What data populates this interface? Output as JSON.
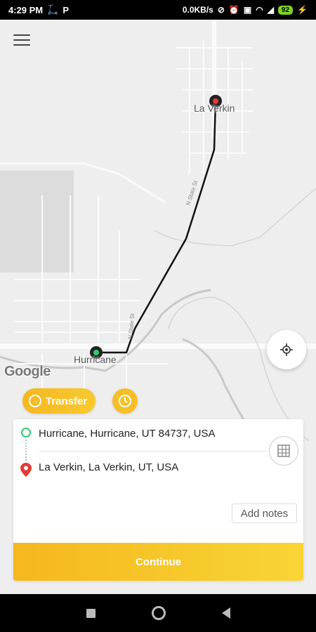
{
  "status_bar": {
    "time": "4:29 PM",
    "network_speed": "0.0KB/s",
    "battery": "92",
    "icons": [
      "scooter-icon",
      "parking-icon",
      "nfc-icon",
      "alarm-icon",
      "sim-icon",
      "wifi-icon",
      "signal-icon",
      "charging-icon"
    ]
  },
  "map": {
    "origin_label": "Hurricane",
    "destination_label": "La Verkin",
    "road_label_1": "N State St",
    "road_label_2": "N State St",
    "attribution": "Google",
    "origin_marker_color": "#2ecc71",
    "destination_marker_color": "#e53935"
  },
  "actions": {
    "transfer_label": "Transfer",
    "accent_color": "#f6bf27"
  },
  "route_card": {
    "pickup_address": "Hurricane, Hurricane, UT 84737, USA",
    "dropoff_address": "La Verkin, La Verkin, UT, USA",
    "add_notes_label": "Add notes",
    "continue_label": "Continue"
  }
}
